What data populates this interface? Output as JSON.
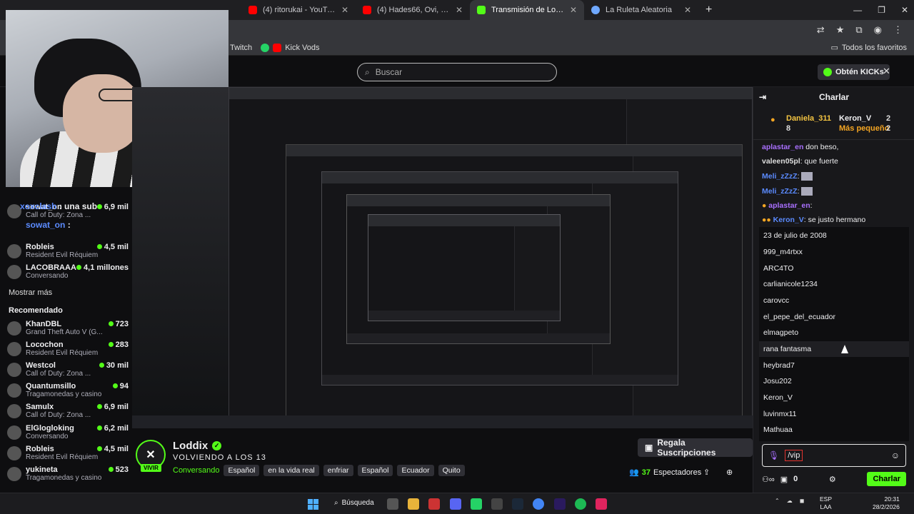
{
  "browser": {
    "tabs": [
      {
        "title": "(4) ritorukai - YouTube",
        "icon": "youtube-icon"
      },
      {
        "title": "(4) Hades66, Ovi, LMR - Si Mijo",
        "icon": "youtube-icon"
      },
      {
        "title": "Transmisión de Loddic mírala e",
        "icon": "kick-icon"
      },
      {
        "title": "La Ruleta Aleatoria",
        "icon": "web-icon"
      }
    ],
    "new_tab": "+",
    "bookmarks": [
      {
        "label": "Twitch"
      },
      {
        "label": "Kick Vods"
      }
    ],
    "all_favorites": "Todos los favoritos"
  },
  "header": {
    "search_placeholder": "Buscar",
    "get_kicks": "Obtén KICKs"
  },
  "sidebar": {
    "overlay_chat": [
      {
        "user": "xoxclash",
        "text": ": una sub"
      },
      {
        "user": "sowat_on",
        "text": ":"
      }
    ],
    "following": [
      {
        "name": "sowat_on",
        "game": "Call of Duty: Zona ...",
        "viewers": "6,9 mil"
      },
      {
        "name": "Robleis",
        "game": "Resident Evil Réquiem",
        "viewers": "4,5 mil"
      },
      {
        "name": "LACOBRAAA",
        "game": "Conversando",
        "viewers": "4,1 millones"
      }
    ],
    "show_more": "Mostrar más",
    "recommended_title": "Recomendado",
    "recommended": [
      {
        "name": "KhanDBL",
        "game": "Grand Theft Auto V (G...",
        "viewers": "723"
      },
      {
        "name": "Locochon",
        "game": "Resident Evil Réquiem",
        "viewers": "283"
      },
      {
        "name": "Westcol",
        "game": "Call of Duty: Zona ...",
        "viewers": "30 mil"
      },
      {
        "name": "Quantumsillo",
        "game": "Tragamonedas y casino",
        "viewers": "94"
      },
      {
        "name": "Samulx",
        "game": "Call of Duty: Zona ...",
        "viewers": "6,9 mil"
      },
      {
        "name": "ElGlogloking",
        "game": "Conversando",
        "viewers": "6,2 mil"
      },
      {
        "name": "Robleis",
        "game": "Resident Evil Réquiem",
        "viewers": "4,5 mil"
      },
      {
        "name": "yukineta",
        "game": "Tragamonedas y casino",
        "viewers": "523"
      }
    ]
  },
  "stream_info": {
    "channel": "Loddix",
    "live_badge": "VIVIR",
    "title": "VOLVIENDO A LOS 13",
    "category": "Conversando",
    "tags": [
      "Español",
      "en la vida real",
      "enfriar",
      "Español",
      "Ecuador",
      "Quito"
    ],
    "subs_button": "Regala Suscripciones",
    "viewers": "37",
    "viewers_label": "Espectadores"
  },
  "chat": {
    "title": "Charlar",
    "leaderboard": [
      {
        "name": "Daniela_311",
        "count": "8"
      },
      {
        "name": "Keron_V",
        "count": "2"
      },
      {
        "name": "Más pequeño",
        "count": "2"
      }
    ],
    "messages": [
      {
        "user": "aplastar_en",
        "text": "don beso,"
      },
      {
        "user": "valeen05pl",
        "text": ": que fuerte"
      },
      {
        "user": "Meli_zZzZ",
        "text": ":"
      },
      {
        "user": "Meli_zZzZ",
        "text": ":"
      },
      {
        "user": "aplastar_en",
        "text": ":"
      },
      {
        "user": "Keron_V",
        "text": ": se justo hermano"
      }
    ],
    "suggestions": [
      "23 de julio de 2008",
      "999_m4rtxx",
      "ARC4TO",
      "carlianicole1234",
      "carovcc",
      "el_pepe_del_ecuador",
      "elmagpeto",
      "rana fantasma",
      "heybrad7",
      "Josu202",
      "Keron_V",
      "luvinmx11",
      "Mathuaa"
    ],
    "input_value": "/vip",
    "footer_points": "0",
    "send_button": "Charlar"
  },
  "taskbar": {
    "search_label": "Búsqueda",
    "lang_top": "ESP",
    "lang_bottom": "LAA",
    "time": "20:31",
    "date": "28/2/2026"
  }
}
